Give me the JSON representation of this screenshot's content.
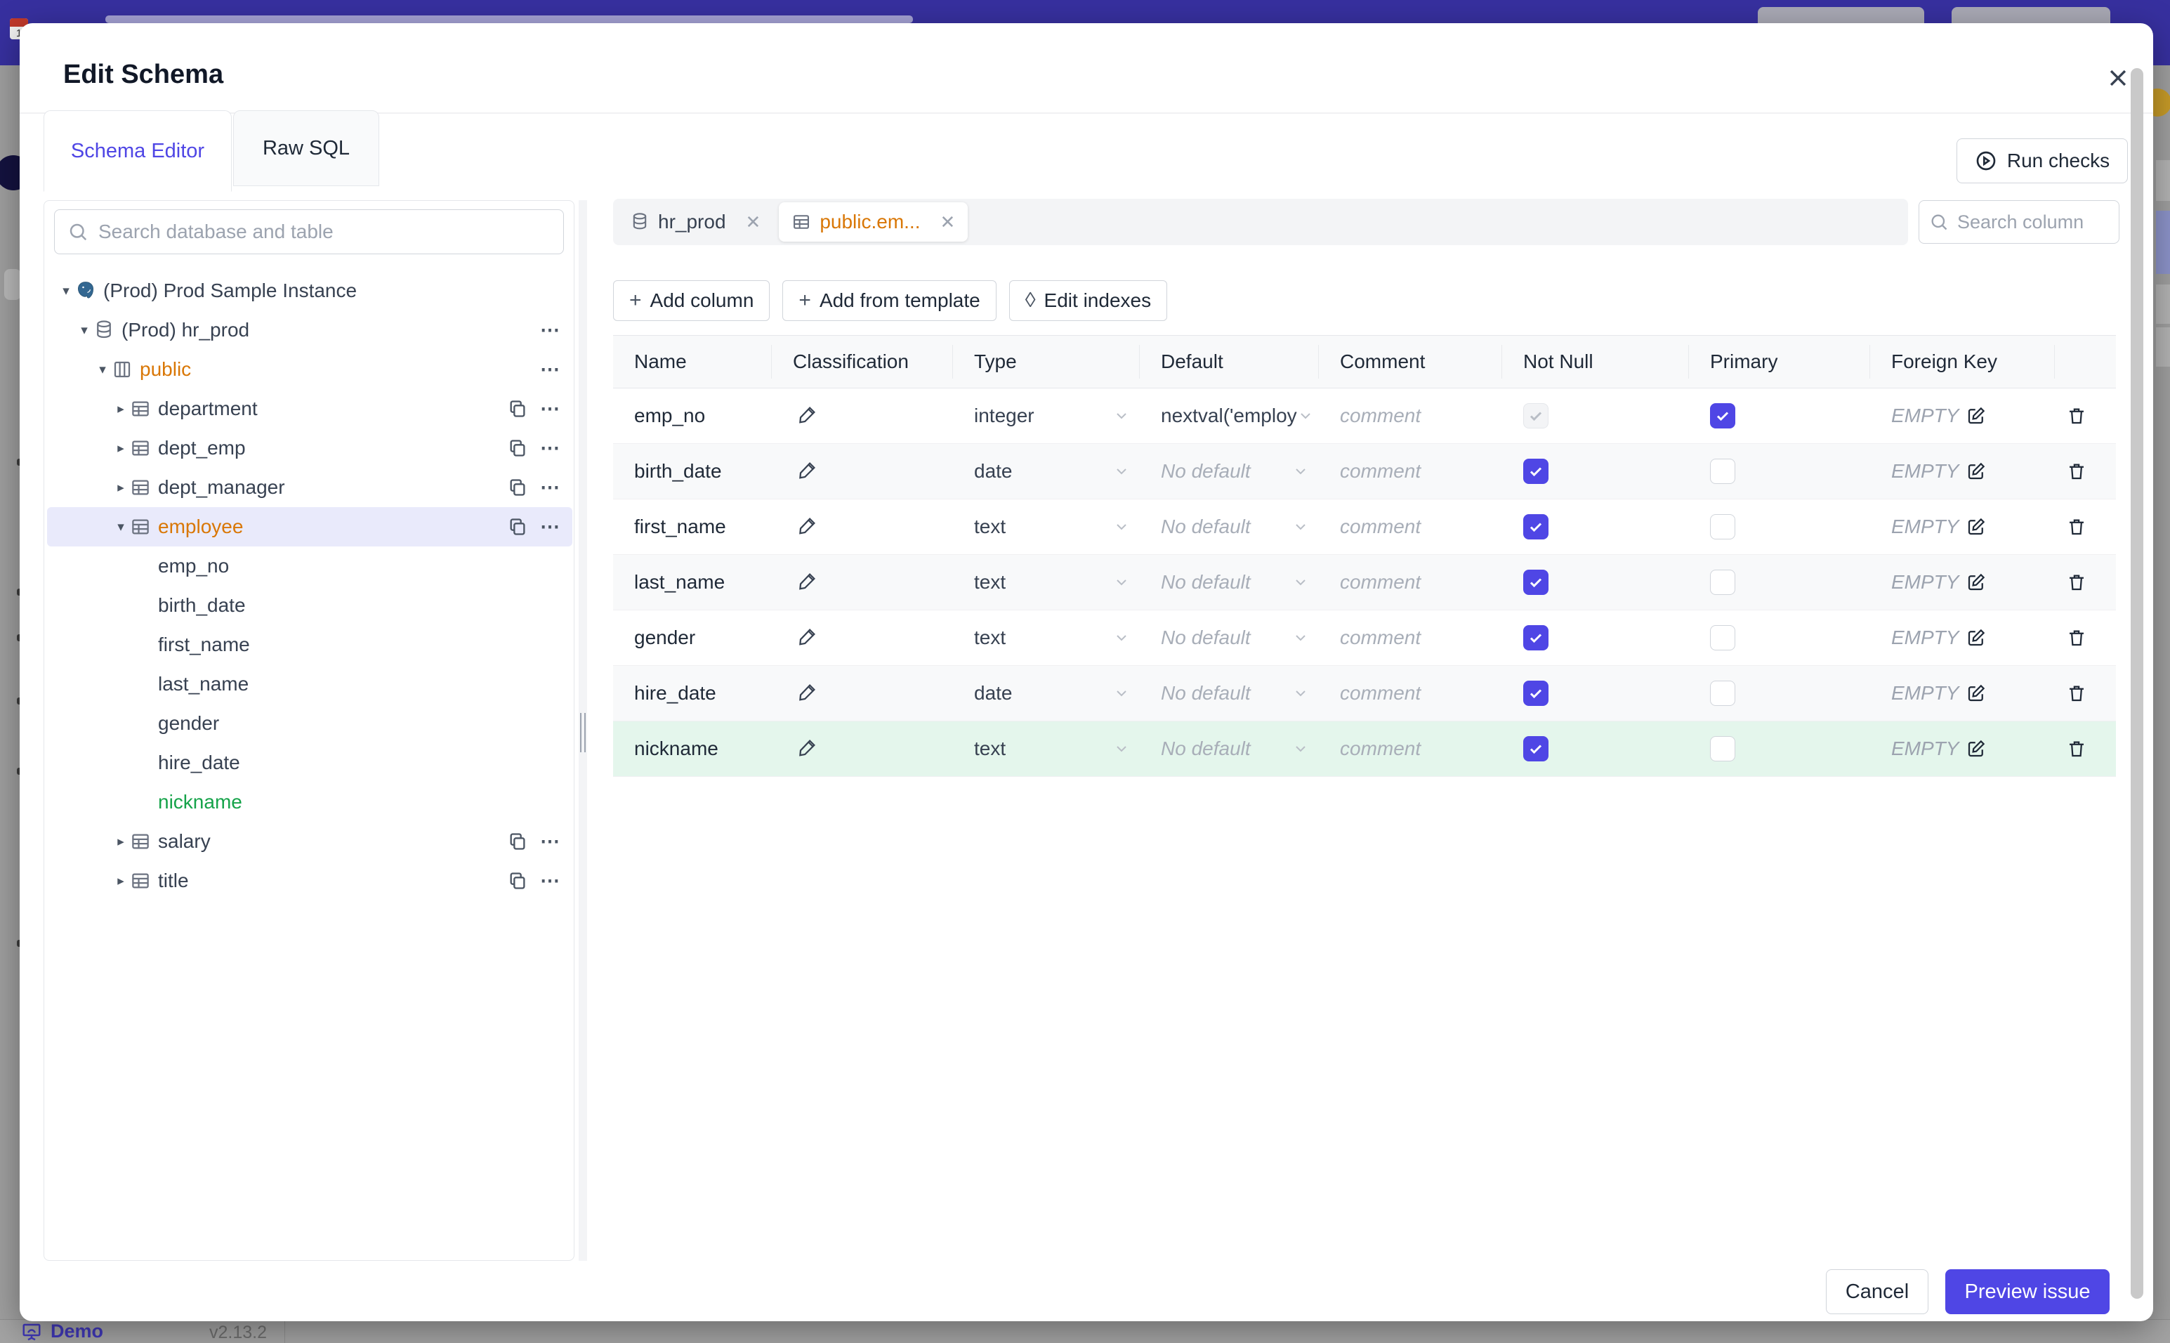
{
  "modal": {
    "title": "Edit Schema",
    "close_icon": "x-icon",
    "tabs": [
      {
        "label": "Schema Editor",
        "active": true
      },
      {
        "label": "Raw SQL",
        "active": false
      }
    ],
    "run_checks_label": "Run checks",
    "footer": {
      "cancel_label": "Cancel",
      "preview_label": "Preview issue"
    }
  },
  "sidebar": {
    "search_placeholder": "Search database and table",
    "tree": [
      {
        "level": 0,
        "arrow": "down",
        "icon": "postgresql",
        "label": "(Prod) Prod Sample Instance",
        "color": "default",
        "trailing": "none",
        "selected": false
      },
      {
        "level": 1,
        "arrow": "down",
        "icon": "database",
        "label": "(Prod) hr_prod",
        "color": "default",
        "trailing": "dots",
        "selected": false
      },
      {
        "level": 2,
        "arrow": "down",
        "icon": "schema",
        "label": "public",
        "color": "amber",
        "trailing": "dots",
        "selected": false
      },
      {
        "level": 3,
        "arrow": "right",
        "icon": "table",
        "label": "department",
        "color": "default",
        "trailing": "copy-dots",
        "selected": false
      },
      {
        "level": 3,
        "arrow": "right",
        "icon": "table",
        "label": "dept_emp",
        "color": "default",
        "trailing": "copy-dots",
        "selected": false
      },
      {
        "level": 3,
        "arrow": "right",
        "icon": "table",
        "label": "dept_manager",
        "color": "default",
        "trailing": "copy-dots",
        "selected": false
      },
      {
        "level": 3,
        "arrow": "down",
        "icon": "table",
        "label": "employee",
        "color": "amber",
        "trailing": "copy-dots",
        "selected": true
      },
      {
        "level": 4,
        "arrow": "none",
        "icon": "none",
        "label": "emp_no",
        "color": "default",
        "trailing": "none",
        "selected": false
      },
      {
        "level": 4,
        "arrow": "none",
        "icon": "none",
        "label": "birth_date",
        "color": "default",
        "trailing": "none",
        "selected": false
      },
      {
        "level": 4,
        "arrow": "none",
        "icon": "none",
        "label": "first_name",
        "color": "default",
        "trailing": "none",
        "selected": false
      },
      {
        "level": 4,
        "arrow": "none",
        "icon": "none",
        "label": "last_name",
        "color": "default",
        "trailing": "none",
        "selected": false
      },
      {
        "level": 4,
        "arrow": "none",
        "icon": "none",
        "label": "gender",
        "color": "default",
        "trailing": "none",
        "selected": false
      },
      {
        "level": 4,
        "arrow": "none",
        "icon": "none",
        "label": "hire_date",
        "color": "default",
        "trailing": "none",
        "selected": false
      },
      {
        "level": 4,
        "arrow": "none",
        "icon": "none",
        "label": "nickname",
        "color": "green",
        "trailing": "none",
        "selected": false
      },
      {
        "level": 3,
        "arrow": "right",
        "icon": "table",
        "label": "salary",
        "color": "default",
        "trailing": "copy-dots",
        "selected": false
      },
      {
        "level": 3,
        "arrow": "right",
        "icon": "table",
        "label": "title",
        "color": "default",
        "trailing": "copy-dots",
        "selected": false
      }
    ]
  },
  "editor": {
    "chips": [
      {
        "label": "hr_prod",
        "icon": "database",
        "active": false
      },
      {
        "label": "public.em...",
        "icon": "table",
        "active": true
      }
    ],
    "column_search_placeholder": "Search column",
    "toolbar": [
      {
        "glyph": "+",
        "label": "Add column"
      },
      {
        "glyph": "+",
        "label": "Add from template"
      },
      {
        "glyph": "◊",
        "label": "Edit indexes"
      }
    ],
    "table": {
      "headers": [
        "Name",
        "Classification",
        "Type",
        "Default",
        "Comment",
        "Not Null",
        "Primary",
        "Foreign Key"
      ],
      "comment_placeholder": "comment",
      "no_default_placeholder": "No default",
      "fk_empty_label": "EMPTY",
      "rows": [
        {
          "name": "emp_no",
          "type": "integer",
          "default": "nextval('employ",
          "default_is_placeholder": false,
          "not_null": "checked-disabled",
          "primary": "checked",
          "highlight": false
        },
        {
          "name": "birth_date",
          "type": "date",
          "default": "No default",
          "default_is_placeholder": true,
          "not_null": "checked",
          "primary": "unchecked",
          "highlight": false
        },
        {
          "name": "first_name",
          "type": "text",
          "default": "No default",
          "default_is_placeholder": true,
          "not_null": "checked",
          "primary": "unchecked",
          "highlight": false
        },
        {
          "name": "last_name",
          "type": "text",
          "default": "No default",
          "default_is_placeholder": true,
          "not_null": "checked",
          "primary": "unchecked",
          "highlight": false
        },
        {
          "name": "gender",
          "type": "text",
          "default": "No default",
          "default_is_placeholder": true,
          "not_null": "checked",
          "primary": "unchecked",
          "highlight": false
        },
        {
          "name": "hire_date",
          "type": "date",
          "default": "No default",
          "default_is_placeholder": true,
          "not_null": "checked",
          "primary": "unchecked",
          "highlight": false
        },
        {
          "name": "nickname",
          "type": "text",
          "default": "No default",
          "default_is_placeholder": true,
          "not_null": "checked",
          "primary": "unchecked",
          "highlight": true
        }
      ]
    }
  },
  "background_page": {
    "footer": {
      "demo_label": "Demo",
      "version": "v2.13.2"
    }
  },
  "colors": {
    "accent": "#4f46e5",
    "topbar": "#37309f",
    "amber_text": "#d97706",
    "green_text": "#16a34a",
    "highlight_row": "#e4f6ec"
  }
}
